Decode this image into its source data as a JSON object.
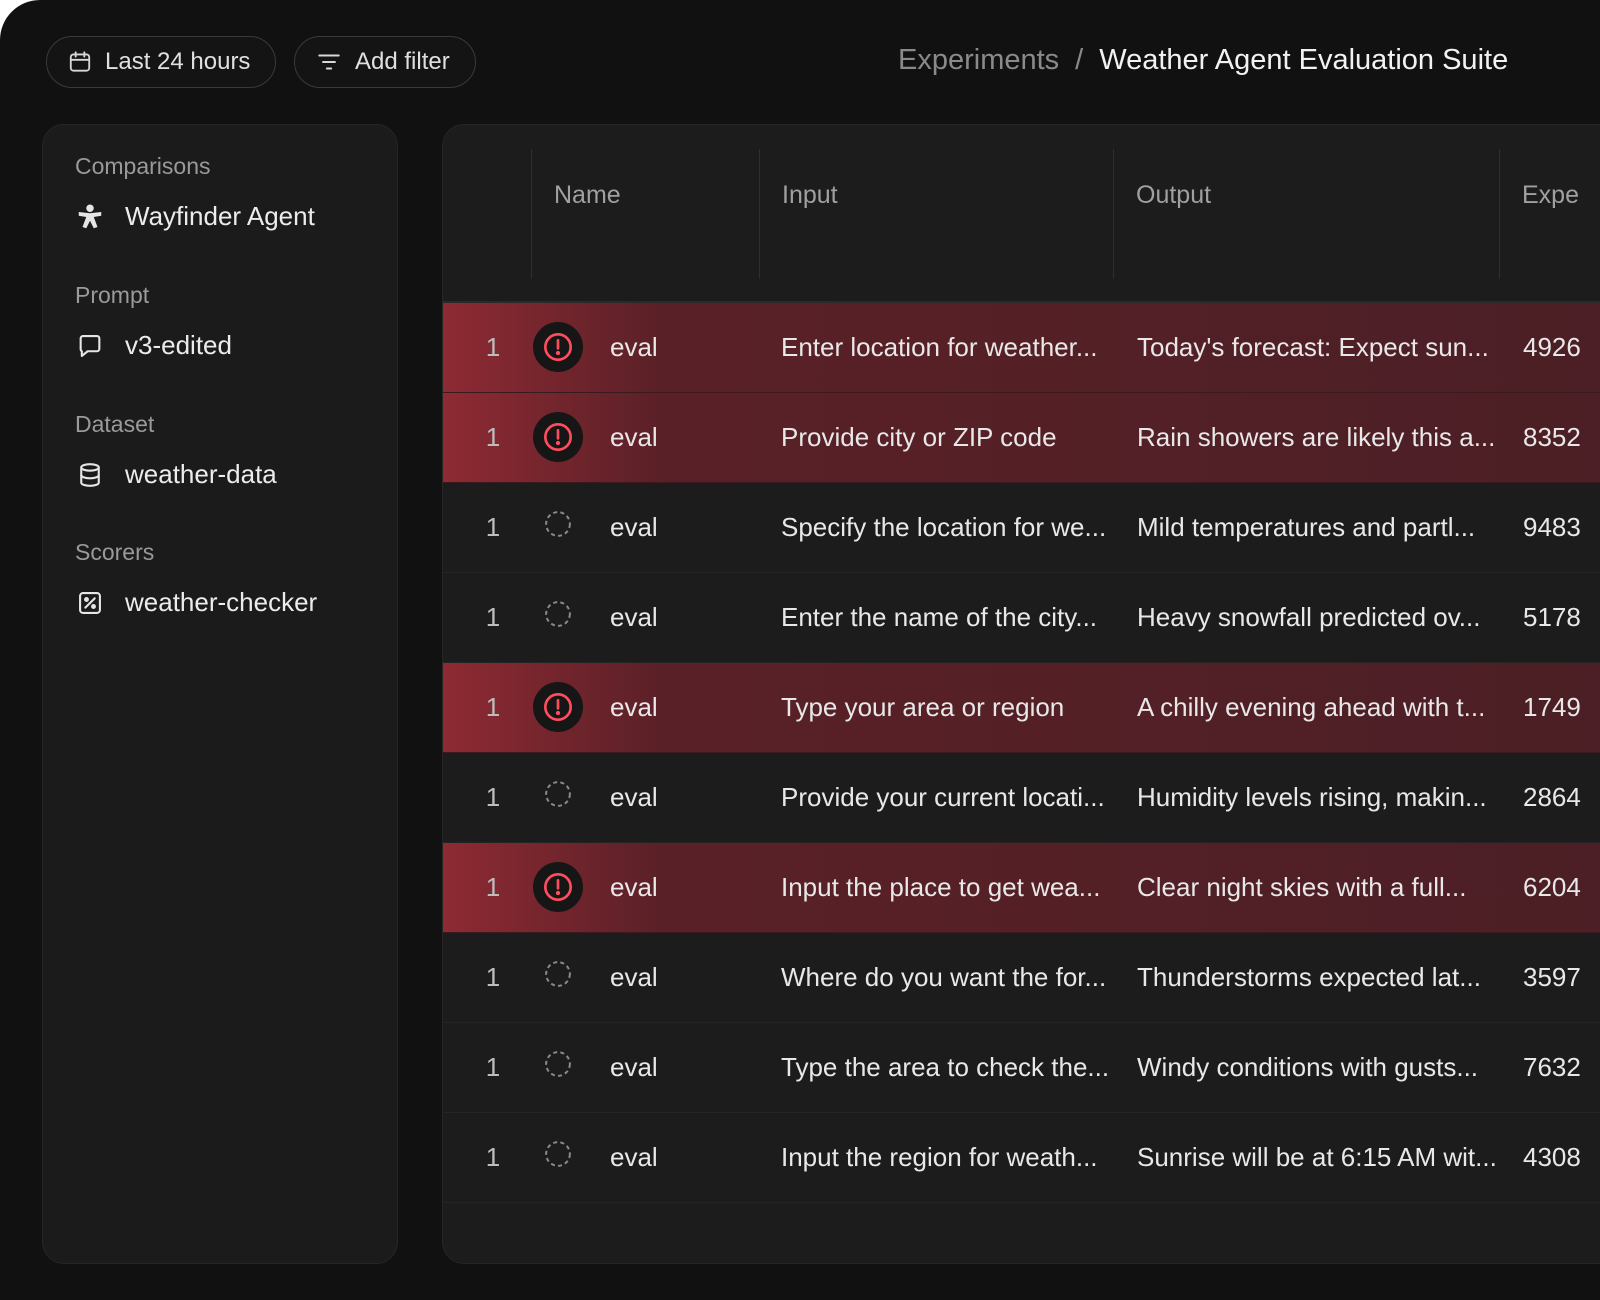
{
  "toolbar": {
    "date_label": "Last 24 hours",
    "filter_label": "Add filter"
  },
  "breadcrumb": {
    "parent": "Experiments",
    "separator": "/",
    "current": "Weather Agent Evaluation Suite"
  },
  "sidebar": {
    "sections": [
      {
        "label": "Comparisons",
        "item": "Wayfinder Agent",
        "icon": "agent-icon"
      },
      {
        "label": "Prompt",
        "item": "v3-edited",
        "icon": "chat-bubble-icon"
      },
      {
        "label": "Dataset",
        "item": "weather-data",
        "icon": "database-icon"
      },
      {
        "label": "Scorers",
        "item": "weather-checker",
        "icon": "percent-icon"
      }
    ]
  },
  "table": {
    "columns": [
      "Name",
      "Input",
      "Output",
      "Expe"
    ],
    "rows": [
      {
        "index": "1",
        "status": "error",
        "name": "eval",
        "input": "Enter location for weather...",
        "output": "Today's forecast: Expect sun...",
        "expected": "4926"
      },
      {
        "index": "1",
        "status": "error",
        "name": "eval",
        "input": "Provide city or ZIP code",
        "output": "Rain showers are likely this a...",
        "expected": "8352"
      },
      {
        "index": "1",
        "status": "pending",
        "name": "eval",
        "input": "Specify the location for we...",
        "output": "Mild temperatures and partl...",
        "expected": "9483"
      },
      {
        "index": "1",
        "status": "pending",
        "name": "eval",
        "input": "Enter the name of the city...",
        "output": "Heavy snowfall predicted ov...",
        "expected": "5178"
      },
      {
        "index": "1",
        "status": "error",
        "name": "eval",
        "input": "Type your area or region",
        "output": "A chilly evening ahead with t...",
        "expected": "1749"
      },
      {
        "index": "1",
        "status": "pending",
        "name": "eval",
        "input": "Provide your current locati...",
        "output": "Humidity levels rising, makin...",
        "expected": "2864"
      },
      {
        "index": "1",
        "status": "error",
        "name": "eval",
        "input": "Input the place to get wea...",
        "output": "Clear night skies with a full...",
        "expected": "6204"
      },
      {
        "index": "1",
        "status": "pending",
        "name": "eval",
        "input": "Where do you want the for...",
        "output": "Thunderstorms expected lat...",
        "expected": "3597"
      },
      {
        "index": "1",
        "status": "pending",
        "name": "eval",
        "input": "Type the area to check the...",
        "output": "Windy conditions with gusts...",
        "expected": "7632"
      },
      {
        "index": "1",
        "status": "pending",
        "name": "eval",
        "input": "Input the region for weath...",
        "output": "Sunrise will be at 6:15 AM wit...",
        "expected": "4308"
      }
    ]
  },
  "colors": {
    "error_accent": "#ff4d5e",
    "error_row": "#4a1f25",
    "background": "#111111"
  }
}
